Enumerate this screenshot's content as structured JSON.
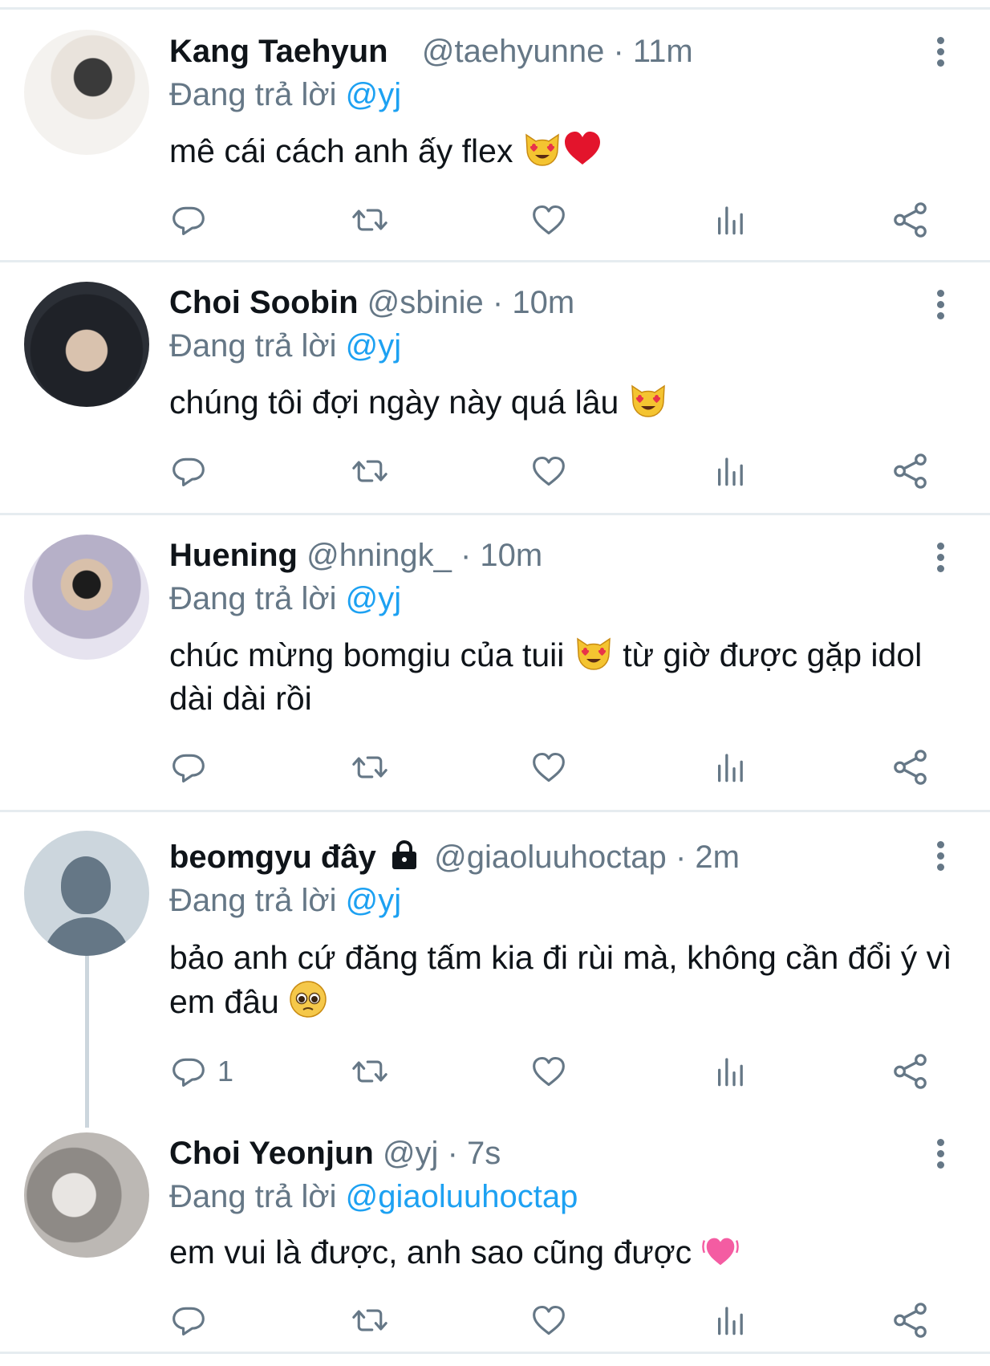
{
  "reply_prefix": "Đang trả lời",
  "colors": {
    "accent": "#1da1f2",
    "muted": "#657786",
    "divider": "#e6ecf0"
  },
  "tweets": [
    {
      "name": "Kang Taehyun",
      "handle": "@taehyunne",
      "time": "11m",
      "replying_to": "@yj",
      "text": "mê cái cách anh ấy flex",
      "emojis": [
        "heart-eyes-cat",
        "red-heart"
      ],
      "reply_count": ""
    },
    {
      "name": "Choi Soobin",
      "handle": "@sbinie",
      "time": "10m",
      "replying_to": "@yj",
      "text": "chúng tôi đợi ngày này quá lâu",
      "emojis": [
        "heart-eyes-cat"
      ],
      "reply_count": ""
    },
    {
      "name": "Huening",
      "handle": "@hningk_",
      "time": "10m",
      "replying_to": "@yj",
      "text_a": "chúc mừng bomgiu của tuii",
      "text_b": "từ giờ được gặp idol dài dài rồi",
      "emojis": [
        "heart-eyes-cat"
      ],
      "reply_count": ""
    },
    {
      "name": "beomgyu đây",
      "protected": true,
      "handle": "@giaoluuhoctap",
      "time": "2m",
      "replying_to": "@yj",
      "text": "bảo anh cứ đăng tấm kia đi rùi mà, không cần đổi ý vì em đâu",
      "emojis": [
        "pleading-face"
      ],
      "reply_count": "1"
    },
    {
      "name": "Choi Yeonjun",
      "handle": "@yj",
      "time": "7s",
      "replying_to": "@giaoluuhoctap",
      "text": "em vui là được, anh sao cũng được",
      "emojis": [
        "growing-heart"
      ],
      "reply_count": ""
    }
  ],
  "action_icons": [
    "reply-icon",
    "retweet-icon",
    "like-icon",
    "analytics-icon",
    "share-icon"
  ]
}
